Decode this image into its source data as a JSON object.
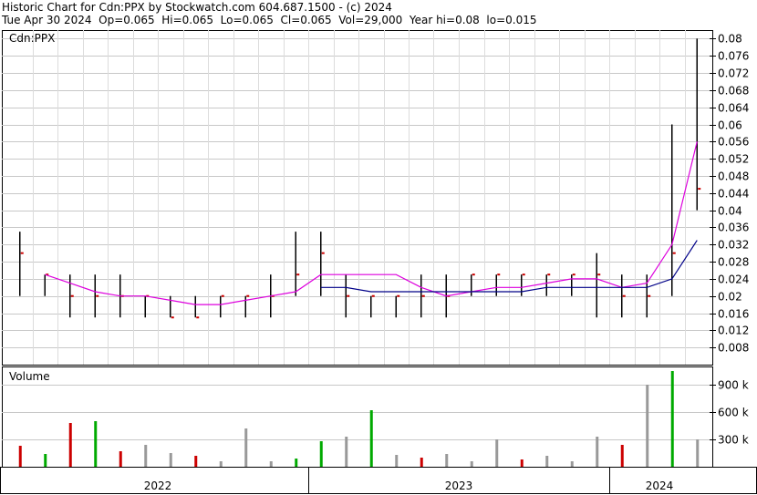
{
  "header": {
    "line1": "Historic Chart for Cdn:PPX by Stockwatch.com 604.687.1500 - (c) 2024",
    "line2": "Tue Apr 30 2024  Op=0.065  Hi=0.065  Lo=0.065  Cl=0.065  Vol=29,000  Year hi=0.08  lo=0.015"
  },
  "chart_data": {
    "type": "line",
    "symbol": "Cdn:PPX",
    "price_panel": {
      "label": "Cdn:PPX",
      "ylim": [
        0.004,
        0.082
      ],
      "yticks": [
        0.08,
        0.076,
        0.072,
        0.068,
        0.064,
        0.06,
        0.056,
        0.052,
        0.048,
        0.044,
        0.04,
        0.036,
        0.032,
        0.028,
        0.024,
        0.02,
        0.016,
        0.012,
        0.008
      ],
      "ytick_labels": [
        "0.08",
        "0.076",
        "0.072",
        "0.068",
        "0.064",
        "0.06",
        "0.056",
        "0.052",
        "0.048",
        "0.044",
        "0.04",
        "0.036",
        "0.032",
        "0.028",
        "0.024",
        "0.02",
        "0.016",
        "0.012",
        "0.008"
      ],
      "x": [
        "2022-01",
        "2022-02",
        "2022-03",
        "2022-04",
        "2022-05",
        "2022-06",
        "2022-07",
        "2022-08",
        "2022-09",
        "2022-10",
        "2022-11",
        "2022-12",
        "2023-01",
        "2023-02",
        "2023-03",
        "2023-04",
        "2023-05",
        "2023-06",
        "2023-07",
        "2023-08",
        "2023-09",
        "2023-10",
        "2023-11",
        "2023-12",
        "2024-01",
        "2024-02",
        "2024-03",
        "2024-04"
      ],
      "series": [
        {
          "name": "",
          "role": "close",
          "color": "#000000",
          "values": [
            0.03,
            0.025,
            0.02,
            0.02,
            0.02,
            0.02,
            0.015,
            0.015,
            0.02,
            0.02,
            0.02,
            0.025,
            0.03,
            0.02,
            0.02,
            0.02,
            0.02,
            0.02,
            0.025,
            0.025,
            0.025,
            0.025,
            0.025,
            0.025,
            0.02,
            0.02,
            0.03,
            0.045
          ],
          "high": [
            0.035,
            0.025,
            0.025,
            0.025,
            0.025,
            0.02,
            0.02,
            0.02,
            0.02,
            0.02,
            0.025,
            0.035,
            0.035,
            0.025,
            0.02,
            0.02,
            0.025,
            0.025,
            0.025,
            0.025,
            0.025,
            0.025,
            0.025,
            0.03,
            0.025,
            0.025,
            0.06,
            0.08
          ],
          "low": [
            0.02,
            0.02,
            0.015,
            0.015,
            0.015,
            0.015,
            0.015,
            0.015,
            0.015,
            0.015,
            0.015,
            0.02,
            0.02,
            0.015,
            0.015,
            0.015,
            0.015,
            0.015,
            0.02,
            0.02,
            0.02,
            0.02,
            0.02,
            0.015,
            0.015,
            0.015,
            0.02,
            0.04
          ]
        },
        {
          "name": "",
          "role": "short-ma",
          "color": "#dd00dd",
          "values": [
            null,
            0.025,
            0.023,
            0.021,
            0.02,
            0.02,
            0.019,
            0.018,
            0.018,
            0.019,
            0.02,
            0.021,
            0.025,
            0.025,
            0.025,
            0.025,
            0.022,
            0.02,
            0.021,
            0.022,
            0.022,
            0.023,
            0.024,
            0.024,
            0.022,
            0.023,
            0.032,
            0.056
          ]
        },
        {
          "name": "",
          "role": "long-ma",
          "color": "#000088",
          "values": [
            null,
            null,
            null,
            null,
            null,
            null,
            null,
            null,
            null,
            null,
            null,
            null,
            0.022,
            0.022,
            0.021,
            0.021,
            0.021,
            0.021,
            0.021,
            0.021,
            0.021,
            0.022,
            0.022,
            0.022,
            0.022,
            0.022,
            0.024,
            0.033
          ]
        }
      ]
    },
    "volume_panel": {
      "label": "Volume",
      "ylim": [
        0,
        1100000
      ],
      "yticks": [
        300000,
        600000,
        900000
      ],
      "ytick_labels": [
        "300 k",
        "600 k",
        "900 k"
      ],
      "values": [
        230000,
        140000,
        480000,
        500000,
        170000,
        240000,
        150000,
        120000,
        60000,
        420000,
        60000,
        90000,
        280000,
        330000,
        620000,
        130000,
        100000,
        140000,
        60000,
        300000,
        80000,
        120000,
        60000,
        330000,
        240000,
        900000,
        1050000,
        300000
      ],
      "colors": [
        "#cc0000",
        "#00aa00",
        "#cc0000",
        "#00aa00",
        "#cc0000",
        "#999999",
        "#999999",
        "#cc0000",
        "#999999",
        "#999999",
        "#999999",
        "#00aa00",
        "#00aa00",
        "#999999",
        "#00aa00",
        "#999999",
        "#cc0000",
        "#999999",
        "#999999",
        "#999999",
        "#cc0000",
        "#999999",
        "#999999",
        "#999999",
        "#cc0000",
        "#999999",
        "#00aa00",
        "#999999"
      ]
    },
    "x_axis": {
      "labels": [
        "2022",
        "2023",
        "2024"
      ],
      "start": "2022-01",
      "end": "2024-04",
      "dividers": [
        "2023-01",
        "2024-01"
      ]
    },
    "grid": true
  }
}
